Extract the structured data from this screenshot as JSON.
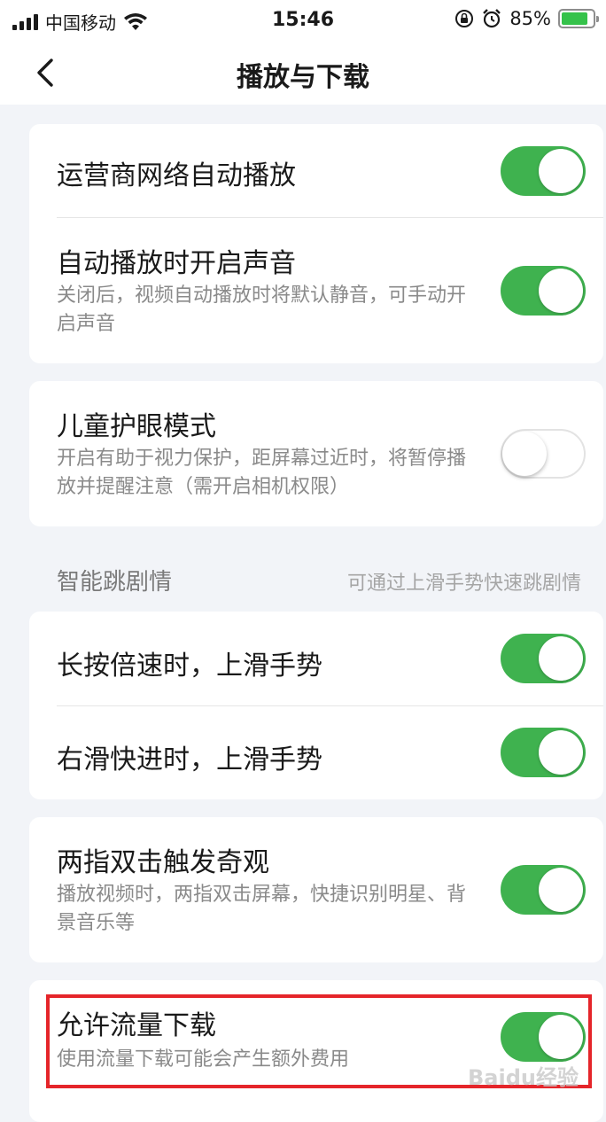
{
  "status_bar": {
    "carrier": "中国移动",
    "time": "15:46",
    "battery_percent_text": "85%",
    "battery_level": 0.85
  },
  "nav": {
    "title": "播放与下载"
  },
  "cards": [
    {
      "rows": [
        {
          "title": "运营商网络自动播放",
          "desc": "",
          "toggle_on": true
        },
        {
          "title": "自动播放时开启声音",
          "desc": "关闭后，视频自动播放时将默认静音，可手动开启声音",
          "toggle_on": true
        }
      ]
    },
    {
      "rows": [
        {
          "title": "儿童护眼模式",
          "desc": "开启有助于视力保护，距屏幕过近时，将暂停播放并提醒注意（需开启相机权限）",
          "toggle_on": false
        }
      ]
    },
    {
      "section": {
        "title": "智能跳剧情",
        "hint": "可通过上滑手势快速跳剧情"
      },
      "rows": [
        {
          "title": "长按倍速时，上滑手势",
          "desc": "",
          "toggle_on": true
        },
        {
          "title": "右滑快进时，上滑手势",
          "desc": "",
          "toggle_on": true
        }
      ]
    },
    {
      "rows": [
        {
          "title": "两指双击触发奇观",
          "desc": "播放视频时，两指双击屏幕，快捷识别明星、背景音乐等",
          "toggle_on": true
        }
      ]
    },
    {
      "rows": [
        {
          "title": "允许流量下载",
          "desc": "使用流量下载可能会产生额外费用",
          "toggle_on": true
        }
      ]
    }
  ],
  "watermark": "Baidu经验",
  "colors": {
    "toggle_on": "#3fb24f",
    "highlight": "#e5252a",
    "background": "#f2f4f8"
  }
}
